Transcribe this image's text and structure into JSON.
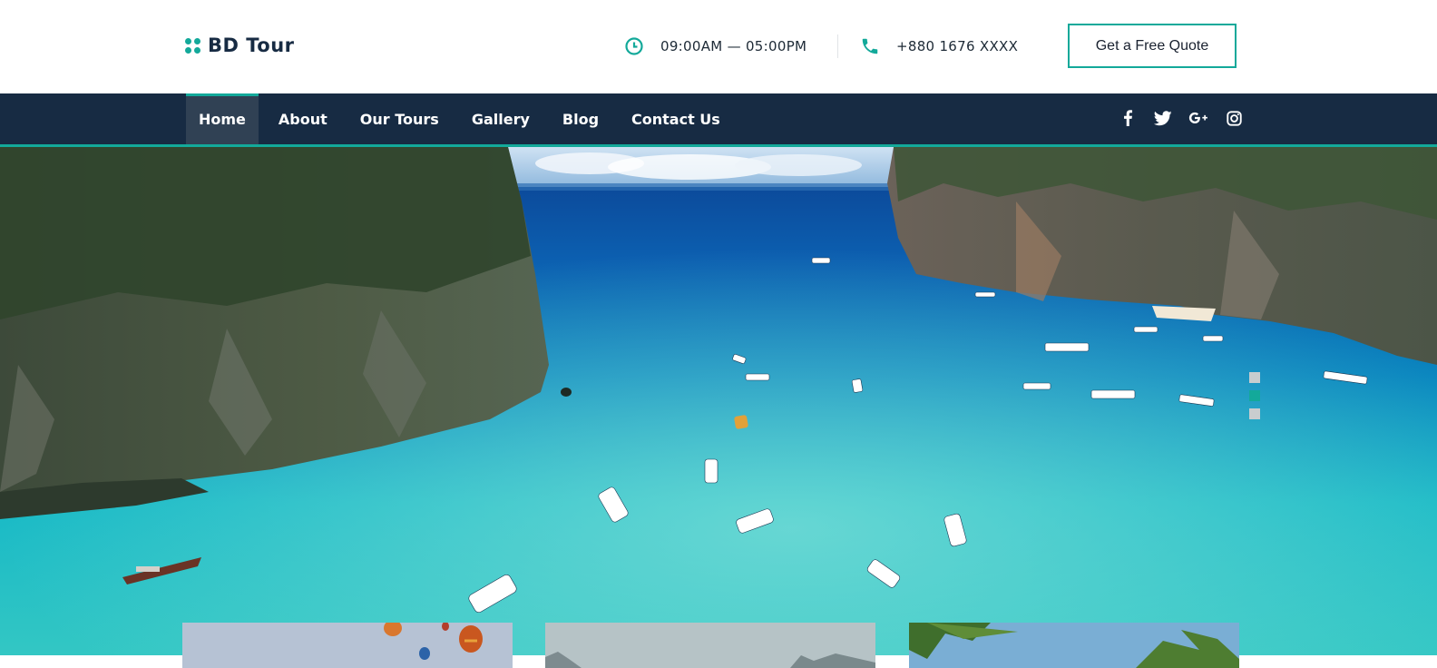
{
  "brand": {
    "name": "BD Tour",
    "accent": "#13a99a",
    "navy": "#172b43"
  },
  "header": {
    "hours": {
      "icon": "clock-icon",
      "text": "09:00AM — 05:00PM"
    },
    "phone": {
      "icon": "phone-icon",
      "text": "+880 1676 XXXX"
    },
    "quote_button": "Get a Free Quote"
  },
  "nav": {
    "items": [
      {
        "label": "Home",
        "active": true
      },
      {
        "label": "About"
      },
      {
        "label": "Our Tours"
      },
      {
        "label": "Gallery"
      },
      {
        "label": "Blog"
      },
      {
        "label": "Contact Us"
      }
    ],
    "social": [
      "facebook-icon",
      "twitter-icon",
      "google-plus-icon",
      "instagram-icon"
    ]
  },
  "hero": {
    "image": "aerial view of turquoise bay between limestone cliffs with boats",
    "slides": 3,
    "active_slide": 2
  },
  "cards": [
    {
      "image": "hot-air-balloons"
    },
    {
      "image": "mountain-landscape"
    },
    {
      "image": "palm-trees-beach"
    }
  ]
}
